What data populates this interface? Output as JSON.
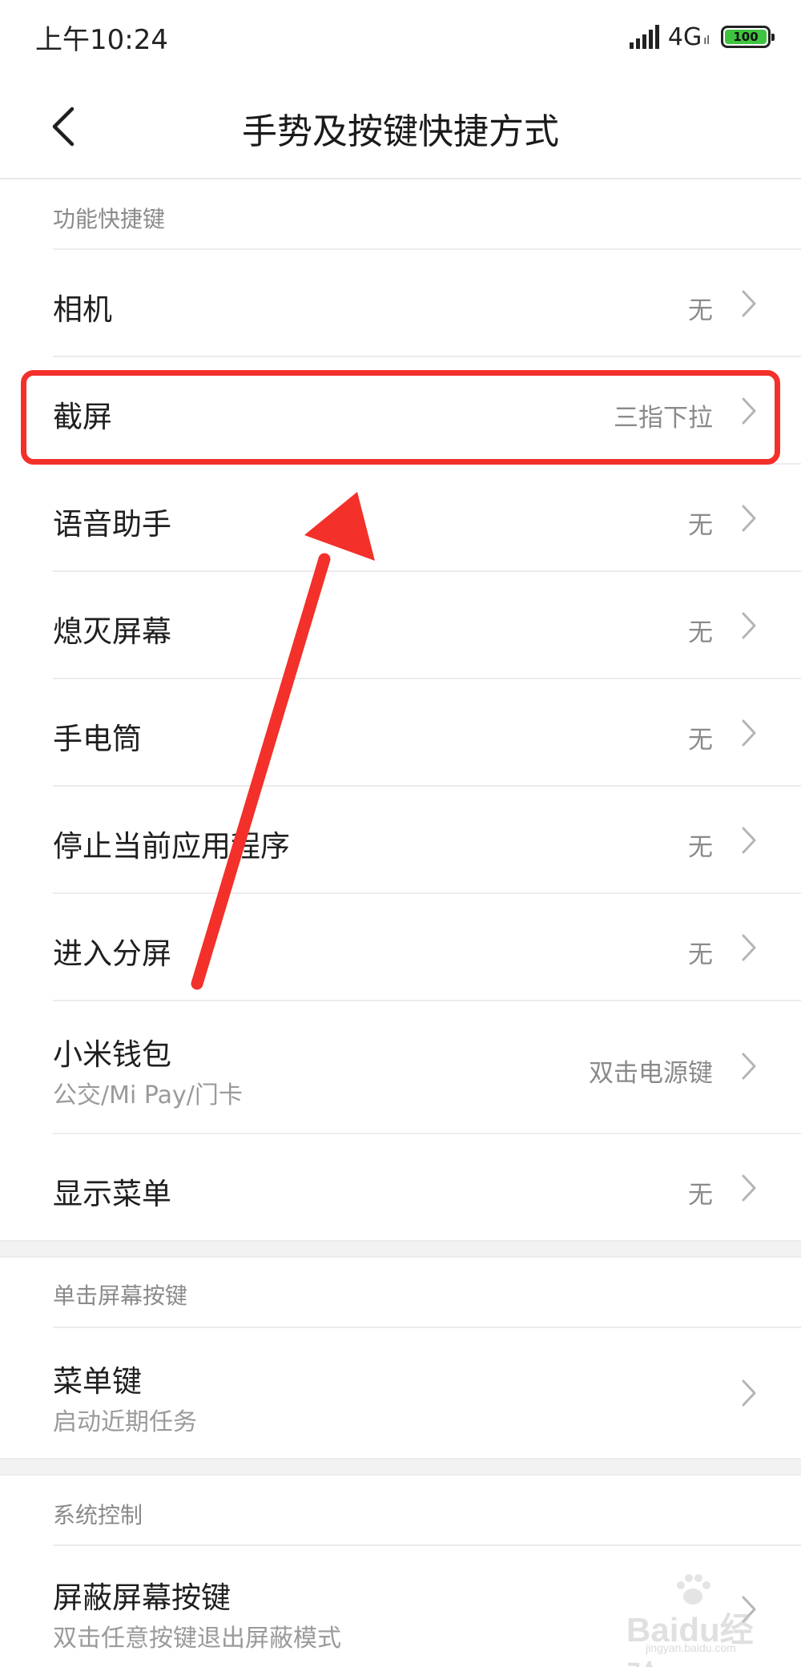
{
  "status_bar": {
    "time": "上午10:24",
    "network": "4G",
    "network_sub": "ıl",
    "battery": "100",
    "battery_color": "#3ec43e"
  },
  "header": {
    "title": "手势及按键快捷方式"
  },
  "sections": [
    {
      "title": "功能快捷键",
      "items": [
        {
          "title": "相机",
          "value": "无"
        },
        {
          "title": "截屏",
          "value": "三指下拉"
        },
        {
          "title": "语音助手",
          "value": "无"
        },
        {
          "title": "熄灭屏幕",
          "value": "无"
        },
        {
          "title": "手电筒",
          "value": "无"
        },
        {
          "title": "停止当前应用程序",
          "value": "无"
        },
        {
          "title": "进入分屏",
          "value": "无"
        },
        {
          "title": "小米钱包",
          "subtitle": "公交/Mi Pay/门卡",
          "value": "双击电源键"
        },
        {
          "title": "显示菜单",
          "value": "无"
        }
      ]
    },
    {
      "title": "单击屏幕按键",
      "items": [
        {
          "title": "菜单键",
          "subtitle": "启动近期任务",
          "value": ""
        }
      ]
    },
    {
      "title": "系统控制",
      "items": [
        {
          "title": "屏蔽屏幕按键",
          "subtitle": "双击任意按键退出屏蔽模式",
          "value": ""
        }
      ]
    }
  ],
  "annotation": {
    "color": "#f3302a"
  },
  "watermark": {
    "text": "Baidu经验",
    "sub": "jingyan.baidu.com"
  }
}
